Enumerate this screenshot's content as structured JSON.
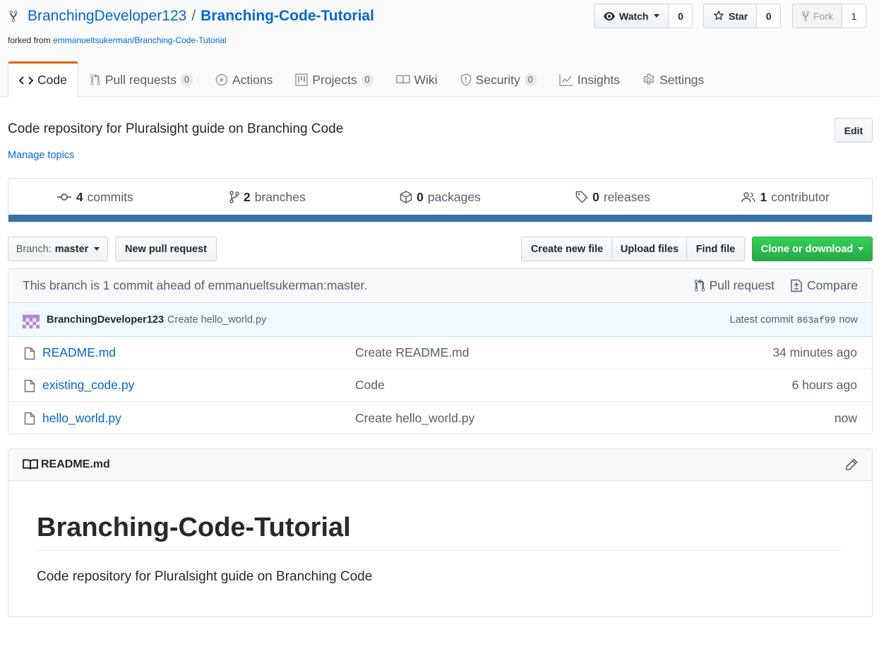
{
  "repo": {
    "owner": "BranchingDeveloper123",
    "separator": "/",
    "name": "Branching-Code-Tutorial",
    "forked_prefix": "forked from ",
    "forked_from": "emmanueltsukerman/Branching-Code-Tutorial"
  },
  "actions": {
    "watch_label": "Watch",
    "watch_count": "0",
    "star_label": "Star",
    "star_count": "0",
    "fork_label": "Fork",
    "fork_count": "1"
  },
  "tabs": [
    {
      "label": "Code",
      "icon": "code-icon"
    },
    {
      "label": "Pull requests",
      "count": "0",
      "icon": "pull-request-icon"
    },
    {
      "label": "Actions",
      "icon": "play-icon"
    },
    {
      "label": "Projects",
      "count": "0",
      "icon": "project-icon"
    },
    {
      "label": "Wiki",
      "icon": "book-icon"
    },
    {
      "label": "Security",
      "count": "0",
      "icon": "shield-icon"
    },
    {
      "label": "Insights",
      "icon": "graph-icon"
    },
    {
      "label": "Settings",
      "icon": "gear-icon"
    }
  ],
  "about": {
    "description": "Code repository for Pluralsight guide on Branching Code",
    "edit_label": "Edit",
    "manage_topics": "Manage topics"
  },
  "summary": [
    {
      "count": "4",
      "label": "commits",
      "icon": "commit-icon"
    },
    {
      "count": "2",
      "label": "branches",
      "icon": "branch-icon"
    },
    {
      "count": "0",
      "label": "packages",
      "icon": "package-icon"
    },
    {
      "count": "0",
      "label": "releases",
      "icon": "tag-icon"
    },
    {
      "count": "1",
      "label": "contributor",
      "icon": "people-icon"
    }
  ],
  "language_bar_color": "#3572a5",
  "toolbar": {
    "branch_prefix": "Branch:",
    "branch_name": "master",
    "new_pull_request": "New pull request",
    "create_new_file": "Create new file",
    "upload_files": "Upload files",
    "find_file": "Find file",
    "clone_or_download": "Clone or download"
  },
  "branch_status": {
    "text": "This branch is 1 commit ahead of emmanueltsukerman:master.",
    "pull_request": "Pull request",
    "compare": "Compare"
  },
  "latest_commit": {
    "author": "BranchingDeveloper123",
    "message": "Create hello_world.py",
    "label": "Latest commit",
    "sha": "863af99",
    "time": "now"
  },
  "files": [
    {
      "name": "README.md",
      "message": "Create README.md",
      "age": "34 minutes ago"
    },
    {
      "name": "existing_code.py",
      "message": "Code",
      "age": "6 hours ago"
    },
    {
      "name": "hello_world.py",
      "message": "Create hello_world.py",
      "age": "now"
    }
  ],
  "readme": {
    "filename": "README.md",
    "heading": "Branching-Code-Tutorial",
    "body": "Code repository for Pluralsight guide on Branching Code"
  }
}
